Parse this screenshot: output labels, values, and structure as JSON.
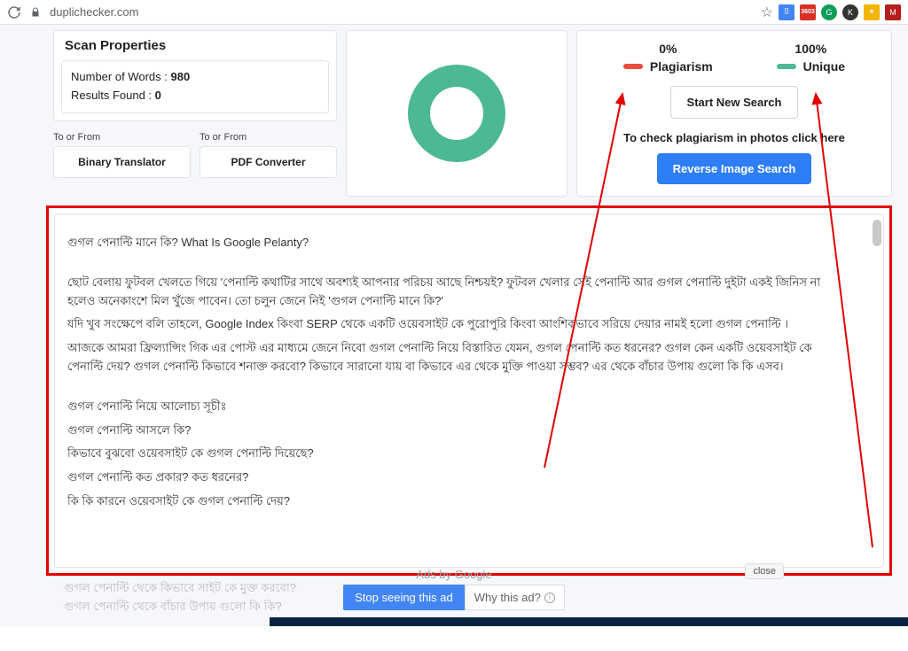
{
  "browser": {
    "url": "duplichecker.com"
  },
  "ext_badges": {
    "gmail": "3603"
  },
  "scan_properties": {
    "title": "Scan Properties",
    "words_label": "Number of Words :",
    "words": "980",
    "results_label": "Results Found :",
    "results": "0"
  },
  "sub_links": {
    "label": "To or From",
    "btn1": "Binary Translator",
    "btn2": "PDF Converter"
  },
  "metrics": {
    "plag_val": "0%",
    "plag_label": "Plagiarism",
    "unique_val": "100%",
    "unique_label": "Unique"
  },
  "actions": {
    "start_new": "Start New Search",
    "check_text": "To check plagiarism in photos click here",
    "reverse": "Reverse Image Search"
  },
  "text_content": {
    "line1": "গুগল পেনাল্টি মানে কি? What Is Google Pelanty?",
    "para2": "ছোট বেলায় ফুটবল খেলতে গিয়ে 'পেনাল্টি কথাটির সাথে অবশ্যই আপনার পরিচয় আছে নিশ্চয়ই? ফুটবল খেলার সেই পেনাল্টি আর গুগল পেনাল্টি দুইটা একই জিনিস না হলেও অনেকাংশে মিল খুঁজে পাবেন। তো চলুন জেনে নিই 'গুগল পেনাল্টি মানে কি?'",
    "para3": "যদি খুব সংক্ষেপে বলি তাহলে,  Google Index কিংবা SERP থেকে একটি ওয়েবসাইট কে পুরোপুরি কিংবা আংশিকভাবে সরিয়ে দেয়ার নামই হলো  গুগল পেনাল্টি ।",
    "para4": "আজকে আমরা ফ্রিল্যান্সিং গিক এর পোস্ট এর মাধ্যমে জেনে নিবো গুগল পেনাল্টি নিয়ে বিস্তারিত যেমন, গুগল পেনাল্টি কত ধরনের?  গুগল কেন একটি ওয়েবসাইট কে পেনাল্টি দেয়? গুগল পেনাল্টি কিভাবে শনাক্ত করবো? কিভাবে সারানো যায় বা কিভাবে এর থেকে মুক্তি পাওয়া সম্ভব? এর থেকে বাঁচার উপায় গুলো কি কি এসব।",
    "para5": "গুগল পেনাল্টি নিয়ে আলোচ্য সূচীঃ",
    "l1": "গুগল পেনাল্টি আসলে কি?",
    "l2": "কিভাবে বুঝবো ওয়েবসাইট কে গুগল পেনাল্টি দিয়েছে?",
    "l3": "গুগল পেনাল্টি কত প্রকার? কত ধরনের?",
    "l4": "কি কি কারনে ওয়েবসাইট কে গুগল পেনাল্টি দেয়?"
  },
  "faded": {
    "f1": "গুগল পেনাল্টি থেকে কিভাবে সাইট কে মুক্ত করবো?",
    "f2": "গুগল পেনাল্টি থেকে বাঁচার উপায় গুলো কি কি?"
  },
  "ads": {
    "label": "Ads by Google",
    "stop": "Stop seeing this ad",
    "why": "Why this ad?"
  },
  "close": "close",
  "chart_data": {
    "type": "pie",
    "title": "",
    "series": [
      {
        "name": "Plagiarism",
        "value": 0,
        "color": "#e74c3c"
      },
      {
        "name": "Unique",
        "value": 100,
        "color": "#4db894"
      }
    ]
  }
}
